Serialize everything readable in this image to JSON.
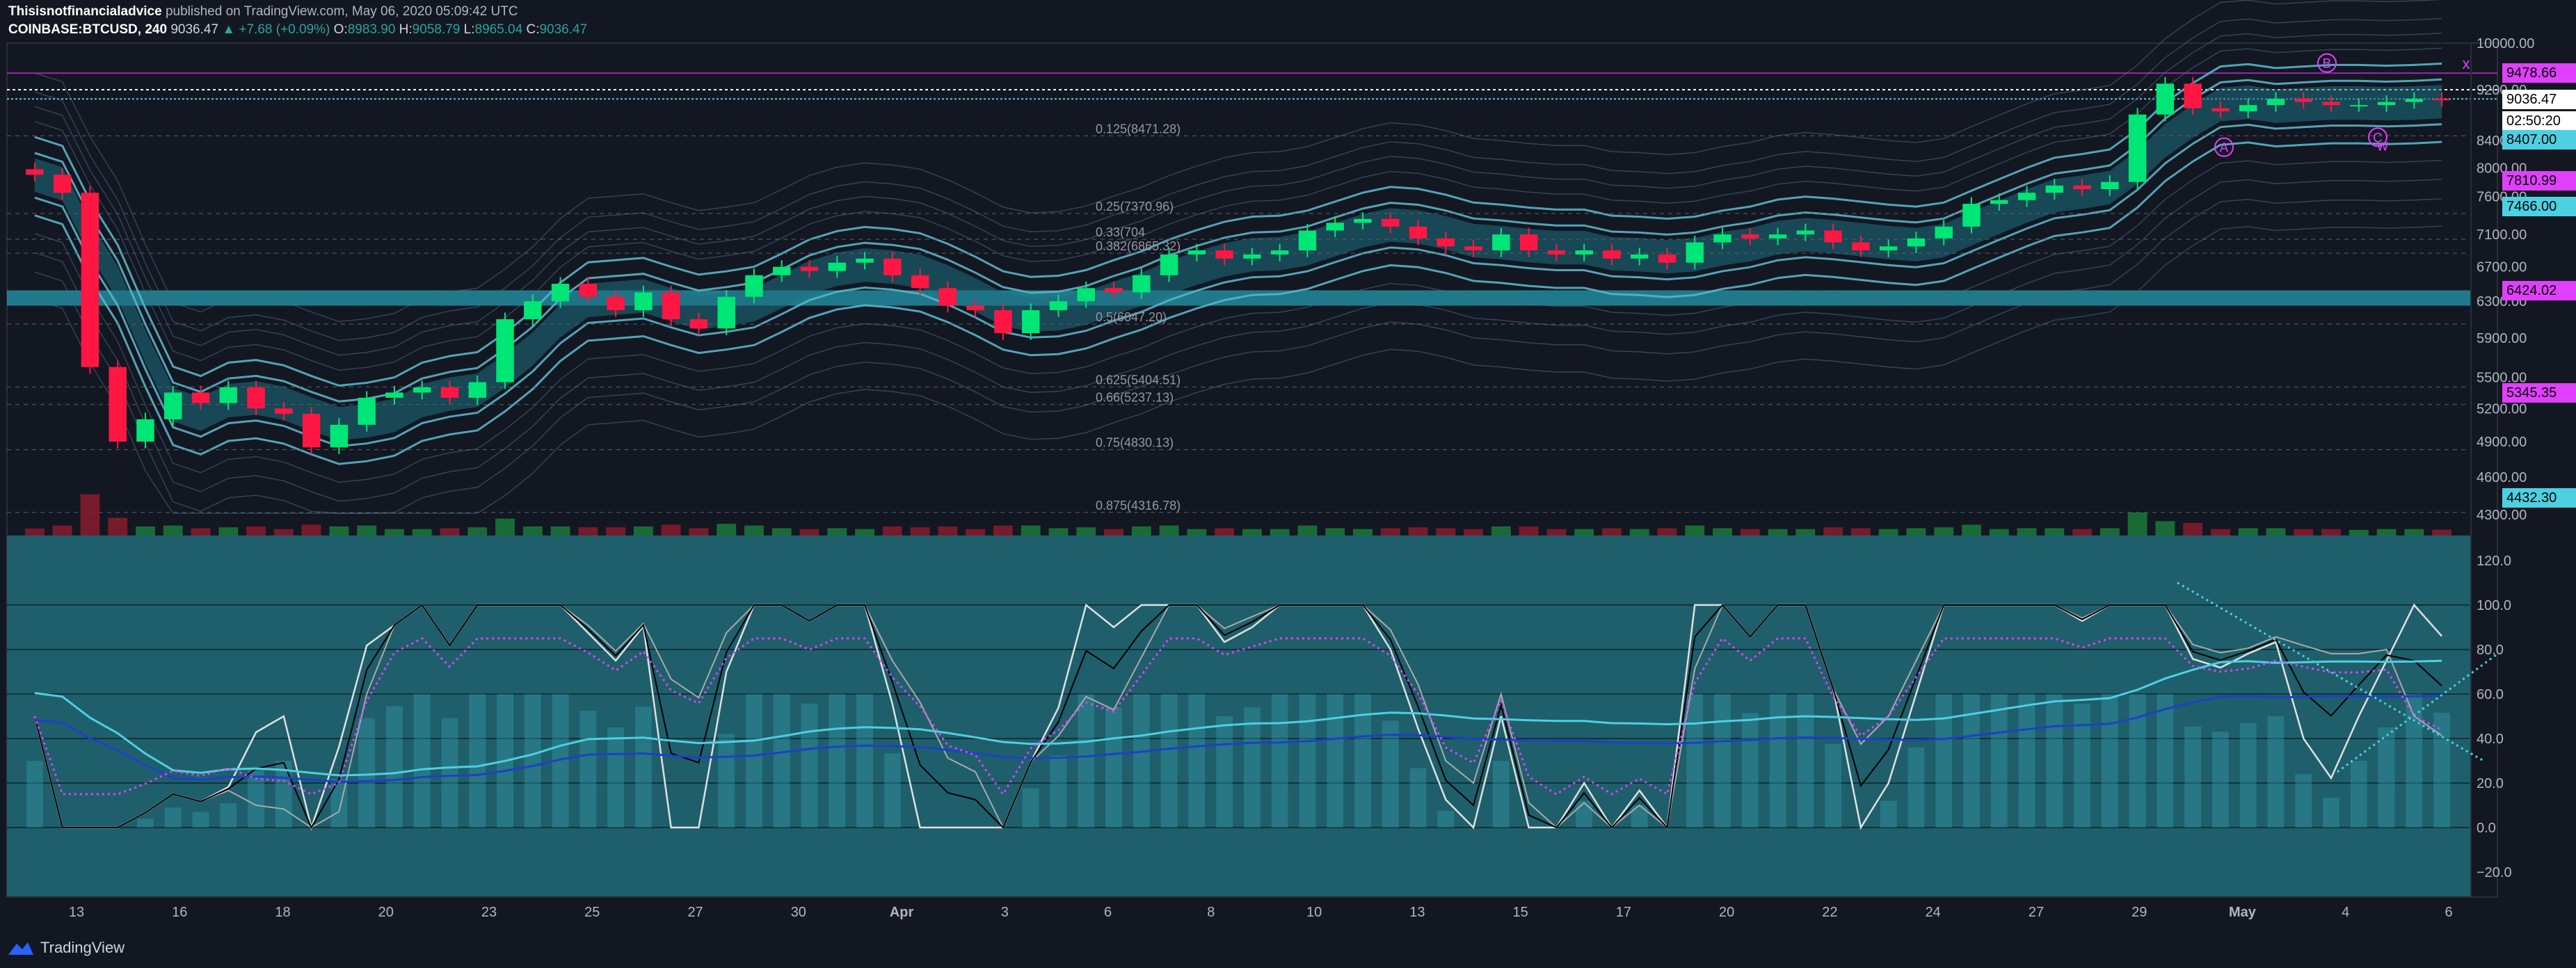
{
  "header": {
    "author": "Thisisnotfinancialadvice",
    "published": "published on TradingView.com, May 06, 2020 05:09:42 UTC",
    "symbol": "COINBASE:BTCUSD, 240",
    "last": "9036.47",
    "change": "▲ +7.68 (+0.09%)",
    "o_label": "O:",
    "o_val": "8983.90",
    "h_label": "H:",
    "h_val": "9058.79",
    "l_label": "L:",
    "l_val": "8965.04",
    "c_label": "C:",
    "c_val": "9036.47"
  },
  "footer": {
    "brand": "TradingView"
  },
  "colors": {
    "bg": "#131722",
    "bull": "#00e676",
    "bear": "#ff1744",
    "band": "#5ab4c8",
    "magenta": "#e040fb",
    "oscillator_bg": "#1e5f6b",
    "cyan_line": "#4dd0e1",
    "blue_line": "#1e40c8"
  },
  "chart_data": {
    "type": "candlestick",
    "price_axis": {
      "ticks": [
        "10000.00",
        "9200.00",
        "8400.00",
        "8000.00",
        "7600.00",
        "7100.00",
        "6700.00",
        "6300.00",
        "5900.00",
        "5500.00",
        "5200.00",
        "4900.00",
        "4600.00",
        "4300.00"
      ],
      "price_range": [
        4300,
        10000
      ]
    },
    "price_tags": [
      {
        "label": "9478.66",
        "bg": "#e040fb",
        "fg": "#000000"
      },
      {
        "label": "9036.47",
        "bg": "#ffffff",
        "fg": "#000000"
      },
      {
        "label": "02:50:20",
        "bg": "#ffffff",
        "fg": "#000000"
      },
      {
        "label": "8407.00",
        "bg": "#4dd0e1",
        "fg": "#000000"
      },
      {
        "label": "7810.99",
        "bg": "#e040fb",
        "fg": "#000000"
      },
      {
        "label": "7466.00",
        "bg": "#4dd0e1",
        "fg": "#000000"
      },
      {
        "label": "6424.02",
        "bg": "#e040fb",
        "fg": "#000000"
      },
      {
        "label": "5345.35",
        "bg": "#e040fb",
        "fg": "#000000"
      },
      {
        "label": "4432.30",
        "bg": "#4dd0e1",
        "fg": "#000000"
      }
    ],
    "fib_levels": [
      {
        "label": "0.125(8471.28)",
        "price": 8471.28
      },
      {
        "label": "0.25(7370.96)",
        "price": 7370.96
      },
      {
        "label": "0.33(704",
        "price": 7040
      },
      {
        "label": "0.382(6865.32)",
        "price": 6865.32
      },
      {
        "label": "0.5(6047.20)",
        "price": 6047.2
      },
      {
        "label": "0.625(5404.51)",
        "price": 5404.51
      },
      {
        "label": "0.66(5237.13)",
        "price": 5237.13
      },
      {
        "label": "0.75(4830.13)",
        "price": 4830.13
      },
      {
        "label": "0.875(4316.78)",
        "price": 4316.78
      }
    ],
    "x_axis": {
      "labels": [
        "13",
        "16",
        "18",
        "20",
        "23",
        "25",
        "27",
        "30",
        "Apr",
        "3",
        "6",
        "8",
        "10",
        "13",
        "15",
        "17",
        "20",
        "22",
        "24",
        "27",
        "29",
        "May",
        "4",
        "6"
      ],
      "bold": [
        "Apr",
        "May"
      ]
    },
    "close_series": [
      7900,
      7650,
      5600,
      4900,
      5100,
      5350,
      5250,
      5400,
      5200,
      5150,
      4850,
      5050,
      5300,
      5350,
      5400,
      5300,
      5450,
      6100,
      6300,
      6500,
      6350,
      6200,
      6400,
      6100,
      6000,
      6350,
      6600,
      6700,
      6650,
      6750,
      6800,
      6600,
      6450,
      6250,
      6200,
      5950,
      6200,
      6300,
      6450,
      6400,
      6600,
      6850,
      6900,
      6800,
      6850,
      6900,
      7150,
      7250,
      7300,
      7200,
      7050,
      6950,
      6900,
      7100,
      6900,
      6850,
      6900,
      6800,
      6850,
      6750,
      7000,
      7100,
      7050,
      7100,
      7150,
      7000,
      6900,
      6950,
      7050,
      7200,
      7500,
      7550,
      7650,
      7750,
      7700,
      7800,
      8800,
      9300,
      8900,
      8850,
      8950,
      9050,
      9000,
      8950,
      8950,
      9000,
      9050,
      9036
    ],
    "oscillator": {
      "axis_ticks": [
        "120.0",
        "100.0",
        "80.0",
        "60.0",
        "40.0",
        "20.0",
        "0.0",
        "−20.0"
      ],
      "range": [
        -25,
        125
      ],
      "levels": [
        100,
        80,
        60,
        40,
        20,
        0
      ]
    },
    "annotations": [
      {
        "label": "B"
      },
      {
        "label": "A"
      },
      {
        "label": "C"
      },
      {
        "label": "W"
      },
      {
        "label": "X"
      }
    ]
  }
}
